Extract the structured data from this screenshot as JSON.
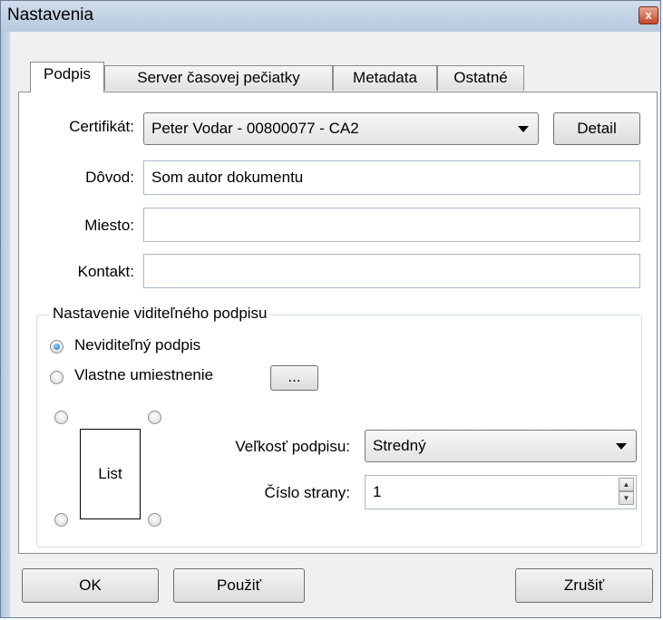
{
  "window": {
    "title": "Nastavenia",
    "close_glyph": "x"
  },
  "tabs": [
    {
      "label": "Podpis"
    },
    {
      "label": "Server časovej pečiatky"
    },
    {
      "label": "Metadata"
    },
    {
      "label": "Ostatné"
    }
  ],
  "form": {
    "certificate_label": "Certifikát:",
    "certificate_value": "Peter Vodar - 00800077 - CA2",
    "detail_button": "Detail",
    "reason_label": "Dôvod:",
    "reason_value": "Som autor dokumentu",
    "place_label": "Miesto:",
    "place_value": "",
    "contact_label": "Kontakt:",
    "contact_value": ""
  },
  "visible_signature": {
    "group_title": "Nastavenie viditeľného podpisu",
    "invisible_label": "Neviditeľný podpis",
    "invisible_selected": true,
    "custom_label": "Vlastne umiestnenie",
    "custom_button": "...",
    "sheet_label": "List",
    "size_label": "Veľkosť podpisu:",
    "size_value": "Stredný",
    "page_label": "Číslo strany:",
    "page_value": "1"
  },
  "footer": {
    "ok": "OK",
    "apply": "Použiť",
    "cancel": "Zrušiť"
  },
  "colors": {
    "titlebar": "#b7c9de",
    "radio_selected": "#1c6fb5"
  }
}
